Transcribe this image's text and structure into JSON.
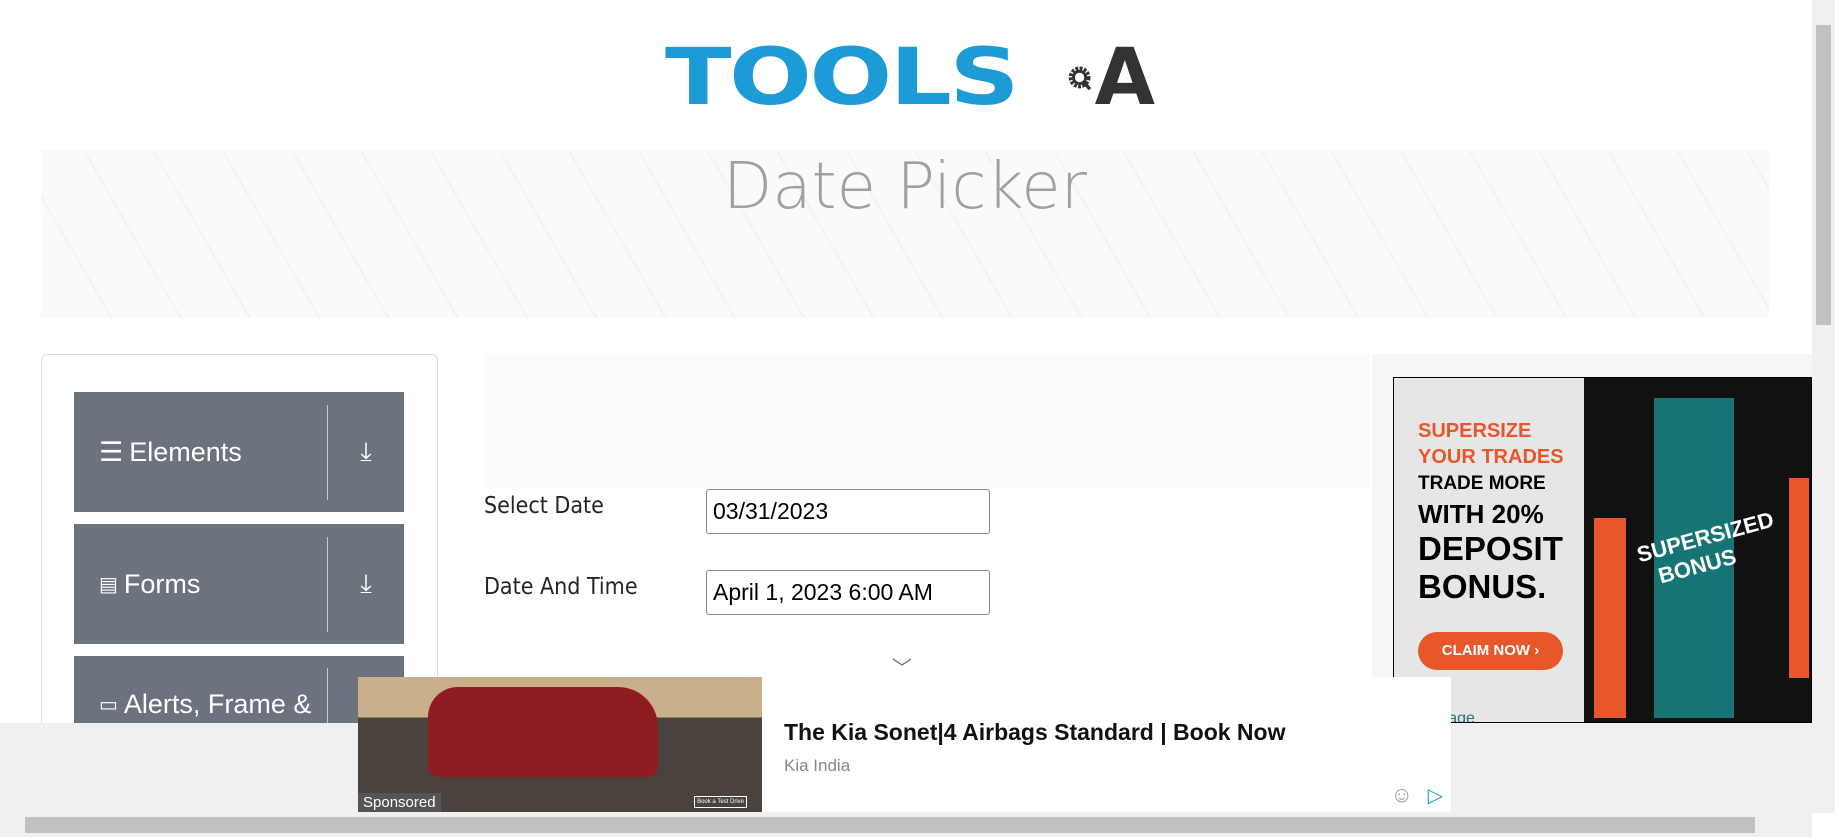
{
  "logo": {
    "text": "TOOLSQA",
    "part1": "TOOLS",
    "part2": "A"
  },
  "page_title": "Date Picker",
  "sidebar": {
    "items": [
      {
        "label": "Elements",
        "icon": "hamburger-icon"
      },
      {
        "label": "Forms",
        "icon": "document-icon"
      },
      {
        "label": "Alerts, Frame &",
        "icon": "window-icon"
      }
    ]
  },
  "form": {
    "select_date_label": "Select Date",
    "select_date_value": "03/31/2023",
    "date_time_label": "Date And Time",
    "date_time_value": "April 1, 2023 6:00 AM"
  },
  "right_ad": {
    "line1": "SUPERSIZE",
    "line2": "YOUR TRADES",
    "line3": "TRADE MORE",
    "line4": "WITH 20%",
    "line5": "DEPOSIT",
    "line6": "BONUS.",
    "cta": "CLAIM NOW",
    "art_text": "SUPERSIZED BONUS",
    "brand": "vantage",
    "accent": "#e8572a"
  },
  "bottom_ad": {
    "headline": "The Kia Sonet|4 Airbags Standard | Book Now",
    "advertiser": "Kia India",
    "sponsored": "Sponsored",
    "image_cta": "Book a Test Drive"
  },
  "colors": {
    "brand_blue": "#1c9bd7",
    "sidebar_bg": "#6c737c"
  }
}
